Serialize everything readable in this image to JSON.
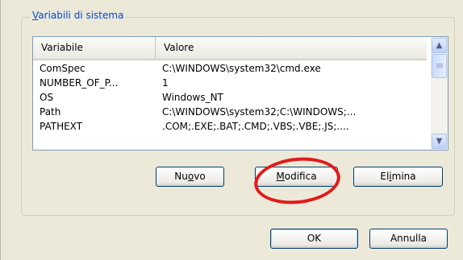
{
  "group": {
    "label_pre": "",
    "label_accel": "V",
    "label_post": "ariabili di sistema"
  },
  "list": {
    "columns": [
      "Variabile",
      "Valore"
    ],
    "rows": [
      {
        "name": "ComSpec",
        "value": "C:\\WINDOWS\\system32\\cmd.exe"
      },
      {
        "name": "NUMBER_OF_P...",
        "value": "1"
      },
      {
        "name": "OS",
        "value": "Windows_NT"
      },
      {
        "name": "Path",
        "value": "C:\\WINDOWS\\system32;C:\\WINDOWS;..."
      },
      {
        "name": "PATHEXT",
        "value": ".COM;.EXE;.BAT;.CMD;.VBS;.VBE;.JS;...."
      }
    ]
  },
  "scrollbar": {
    "up_glyph": "▲",
    "down_glyph": "▼"
  },
  "buttons": {
    "nuovo": {
      "pre": "Nu",
      "accel": "o",
      "post": "vo"
    },
    "modifica": {
      "pre": "",
      "accel": "M",
      "post": "odifica"
    },
    "elimina": {
      "pre": "El",
      "accel": "i",
      "post": "mina"
    },
    "ok": "OK",
    "annulla": "Annulla"
  },
  "annotation": {
    "color": "#e11a1a",
    "shape": "ellipse-around-modifica"
  },
  "colors": {
    "dialog_bg": "#ece9d8",
    "group_label": "#0046d5",
    "list_border": "#7f9db9",
    "button_border": "#003c74"
  }
}
